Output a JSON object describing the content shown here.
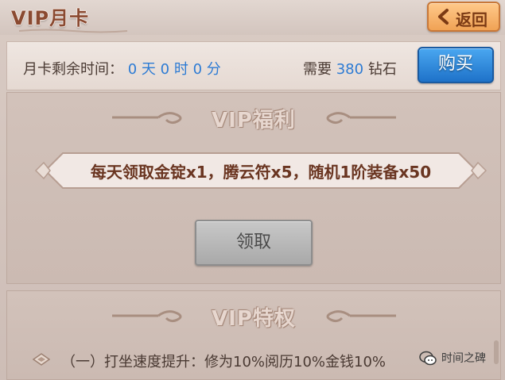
{
  "header": {
    "title": "VIP月卡",
    "back_label": "返回"
  },
  "info": {
    "remain_label": "月卡剩余时间：",
    "days": "0",
    "days_unit": "天",
    "hours": "0",
    "hours_unit": "时",
    "minutes": "0",
    "minutes_unit": "分",
    "need_prefix": "需要",
    "cost": "380",
    "currency": "钻石",
    "buy_label": "购买"
  },
  "benefit": {
    "title": "VIP福利",
    "reward_text": "每天领取金锭x1，腾云符x5，随机1阶装备x50",
    "claim_label": "领取"
  },
  "privilege": {
    "title": "VIP特权",
    "items": [
      {
        "text": "（一）打坐速度提升：修为10%阅历10%金钱10%"
      }
    ]
  },
  "watermark": {
    "text": "时间之碑"
  },
  "colors": {
    "accent_blue": "#2d7bd4",
    "title_brown": "#8a4a31",
    "back_orange": "#f0a255",
    "buy_blue": "#1e72c9"
  }
}
